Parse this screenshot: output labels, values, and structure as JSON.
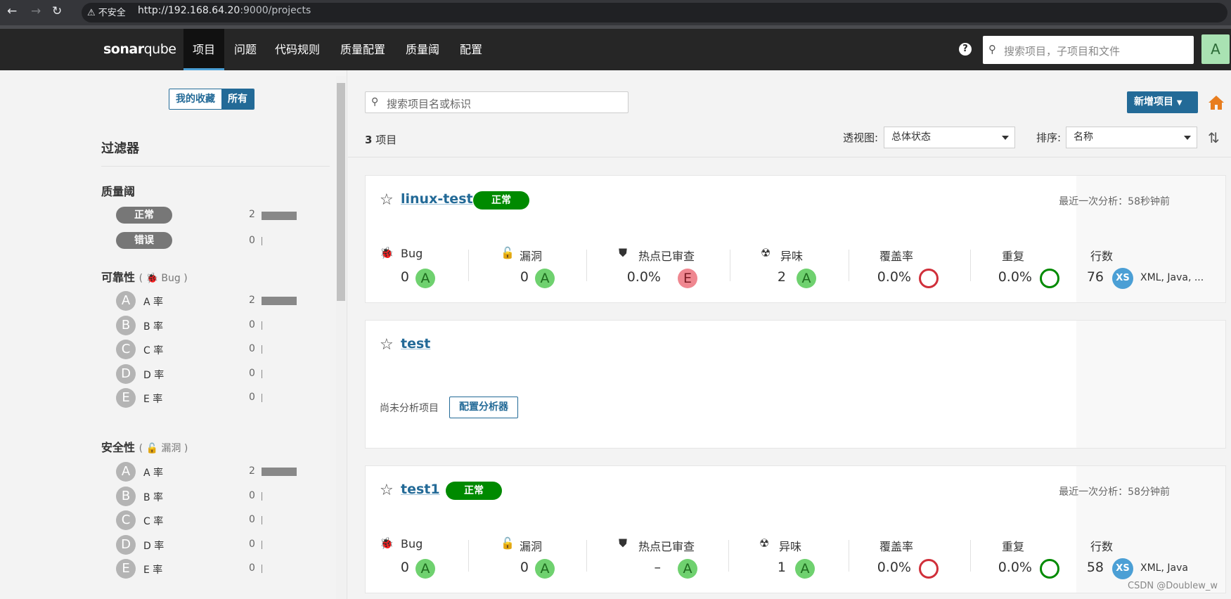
{
  "browser": {
    "insecure_label": "不安全",
    "url_host": "http://192.168.64.20",
    "url_rest": ":9000/projects"
  },
  "topnav": {
    "logo_bold": "sonar",
    "logo_normal": "qube",
    "items": [
      "项目",
      "问题",
      "代码规则",
      "质量配置",
      "质量阈",
      "配置"
    ],
    "help": "?",
    "search_placeholder": "搜索项目，子项目和文件",
    "avatar": "A"
  },
  "sidebar": {
    "fav_mine": "我的收藏",
    "fav_all": "所有",
    "filters_title": "过滤器",
    "quality_gate": {
      "title": "质量阈",
      "items": [
        {
          "label": "正常",
          "count": "2",
          "fraction": 1.0
        },
        {
          "label": "错误",
          "count": "0",
          "fraction": 0
        }
      ]
    },
    "reliability": {
      "title": "可靠性",
      "sub": "Bug",
      "items": [
        {
          "grade": "A",
          "label": "A 率",
          "count": "2",
          "fraction": 1.0
        },
        {
          "grade": "B",
          "label": "B 率",
          "count": "0",
          "fraction": 0
        },
        {
          "grade": "C",
          "label": "C 率",
          "count": "0",
          "fraction": 0
        },
        {
          "grade": "D",
          "label": "D 率",
          "count": "0",
          "fraction": 0
        },
        {
          "grade": "E",
          "label": "E 率",
          "count": "0",
          "fraction": 0
        }
      ]
    },
    "security": {
      "title": "安全性",
      "sub": "漏洞",
      "items": [
        {
          "grade": "A",
          "label": "A 率",
          "count": "2",
          "fraction": 1.0
        },
        {
          "grade": "B",
          "label": "B 率",
          "count": "0",
          "fraction": 0
        },
        {
          "grade": "C",
          "label": "C 率",
          "count": "0",
          "fraction": 0
        },
        {
          "grade": "D",
          "label": "D 率",
          "count": "0",
          "fraction": 0
        },
        {
          "grade": "E",
          "label": "E 率",
          "count": "0",
          "fraction": 0
        }
      ]
    }
  },
  "main": {
    "search_placeholder": "搜索项目名或标识",
    "new_project": "新增项目",
    "count_num": "3",
    "count_unit": " 项目",
    "view_label": "透视图:",
    "view_value": "总体状态",
    "sort_label": "排序:",
    "sort_value": "名称"
  },
  "metric_labels": {
    "bug": "Bug",
    "vuln": "漏洞",
    "hotspot": "热点已审查",
    "smell": "异味",
    "coverage": "覆盖率",
    "dup": "重复",
    "lines": "行数"
  },
  "projects": [
    {
      "name": "linux-test",
      "gate": "正常",
      "last_analysis": "最近一次分析：58秒钟前",
      "bug": "0",
      "bug_rating": "A",
      "vuln": "0",
      "vuln_rating": "A",
      "hotspot": "0.0%",
      "hotspot_rating": "E",
      "smell": "2",
      "smell_rating": "A",
      "coverage": "0.0%",
      "dup": "0.0%",
      "lines": "76",
      "size": "XS",
      "langs": "XML, Java, ..."
    },
    {
      "name": "test",
      "not_analyzed": "尚未分析项目",
      "config_button": "配置分析器"
    },
    {
      "name": "test1",
      "gate": "正常",
      "last_analysis": "最近一次分析：58分钟前",
      "bug": "0",
      "bug_rating": "A",
      "vuln": "0",
      "vuln_rating": "A",
      "hotspot": "–",
      "hotspot_rating": "A",
      "smell": "1",
      "smell_rating": "A",
      "coverage": "0.0%",
      "dup": "0.0%",
      "lines": "58",
      "size": "XS",
      "langs": "XML, Java"
    }
  ],
  "watermark": "CSDN @Doublew_w",
  "colors": {
    "brand": "#236a97",
    "gate_ok": "#008a00",
    "rating_a": "#6fd16f",
    "rating_e": "#ef8790",
    "coverage_bad": "#d02f3a"
  }
}
